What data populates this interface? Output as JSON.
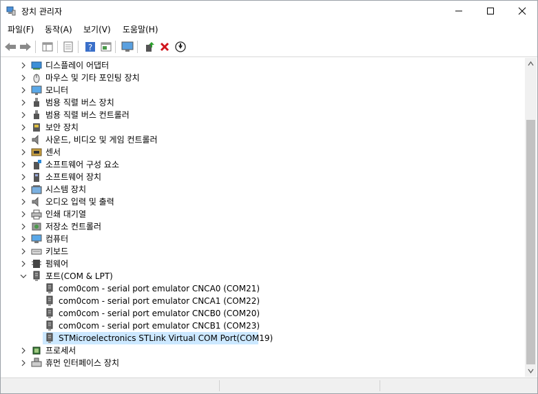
{
  "window": {
    "title": "장치 관리자"
  },
  "titlebar_buttons": {
    "minimize": "—",
    "maximize": "☐",
    "close": "✕"
  },
  "menu": [
    "파일(F)",
    "동작(A)",
    "보기(V)",
    "도움말(H)"
  ],
  "toolbar": [
    "back-icon",
    "forward-icon",
    "properties-pane-icon",
    "console-icon",
    "help-icon",
    "action-pane-icon",
    "monitor-icon",
    "update-driver-icon",
    "uninstall-icon",
    "download-icon"
  ],
  "tree": [
    {
      "label": "디스플레이 어댑터",
      "icon": "display-adapter-icon",
      "state": "collapsed",
      "level": 0
    },
    {
      "label": "마우스 및 기타 포인팅 장치",
      "icon": "mouse-icon",
      "state": "collapsed",
      "level": 0
    },
    {
      "label": "모니터",
      "icon": "monitor-icon",
      "state": "collapsed",
      "level": 0
    },
    {
      "label": "범용 직렬 버스 장치",
      "icon": "usb-icon",
      "state": "collapsed",
      "level": 0
    },
    {
      "label": "범용 직렬 버스 컨트롤러",
      "icon": "usb-icon",
      "state": "collapsed",
      "level": 0
    },
    {
      "label": "보안 장치",
      "icon": "security-key-icon",
      "state": "collapsed",
      "level": 0
    },
    {
      "label": "사운드, 비디오 및 게임 컨트롤러",
      "icon": "speaker-icon",
      "state": "collapsed",
      "level": 0
    },
    {
      "label": "센서",
      "icon": "sensor-icon",
      "state": "collapsed",
      "level": 0
    },
    {
      "label": "소프트웨어 구성 요소",
      "icon": "software-component-icon",
      "state": "collapsed",
      "level": 0
    },
    {
      "label": "소프트웨어 장치",
      "icon": "software-device-icon",
      "state": "collapsed",
      "level": 0
    },
    {
      "label": "시스템 장치",
      "icon": "system-device-icon",
      "state": "collapsed",
      "level": 0
    },
    {
      "label": "오디오 입력 및 출력",
      "icon": "speaker-icon",
      "state": "collapsed",
      "level": 0
    },
    {
      "label": "인쇄 대기열",
      "icon": "printer-icon",
      "state": "collapsed",
      "level": 0
    },
    {
      "label": "저장소 컨트롤러",
      "icon": "storage-controller-icon",
      "state": "collapsed",
      "level": 0
    },
    {
      "label": "컴퓨터",
      "icon": "computer-icon",
      "state": "collapsed",
      "level": 0
    },
    {
      "label": "키보드",
      "icon": "keyboard-icon",
      "state": "collapsed",
      "level": 0
    },
    {
      "label": "펌웨어",
      "icon": "firmware-icon",
      "state": "collapsed",
      "level": 0
    },
    {
      "label": "포트(COM & LPT)",
      "icon": "port-icon",
      "state": "expanded",
      "level": 0
    },
    {
      "label": "com0com - serial port emulator CNCA0 (COM21)",
      "icon": "port-icon",
      "state": "leaf",
      "level": 1
    },
    {
      "label": "com0com - serial port emulator CNCA1 (COM22)",
      "icon": "port-icon",
      "state": "leaf",
      "level": 1
    },
    {
      "label": "com0com - serial port emulator CNCB0 (COM20)",
      "icon": "port-icon",
      "state": "leaf",
      "level": 1
    },
    {
      "label": "com0com - serial port emulator CNCB1 (COM23)",
      "icon": "port-icon",
      "state": "leaf",
      "level": 1
    },
    {
      "label": "STMicroelectronics STLink Virtual COM Port(COM19)",
      "icon": "port-icon",
      "state": "leaf",
      "level": 1,
      "selected": true
    },
    {
      "label": "프로세서",
      "icon": "processor-icon",
      "state": "collapsed",
      "level": 0
    },
    {
      "label": "휴먼 인터페이스 장치",
      "icon": "hid-icon",
      "state": "collapsed",
      "level": 0
    }
  ],
  "colors": {
    "selection": "#cce8ff",
    "accent": "#0078d7"
  }
}
